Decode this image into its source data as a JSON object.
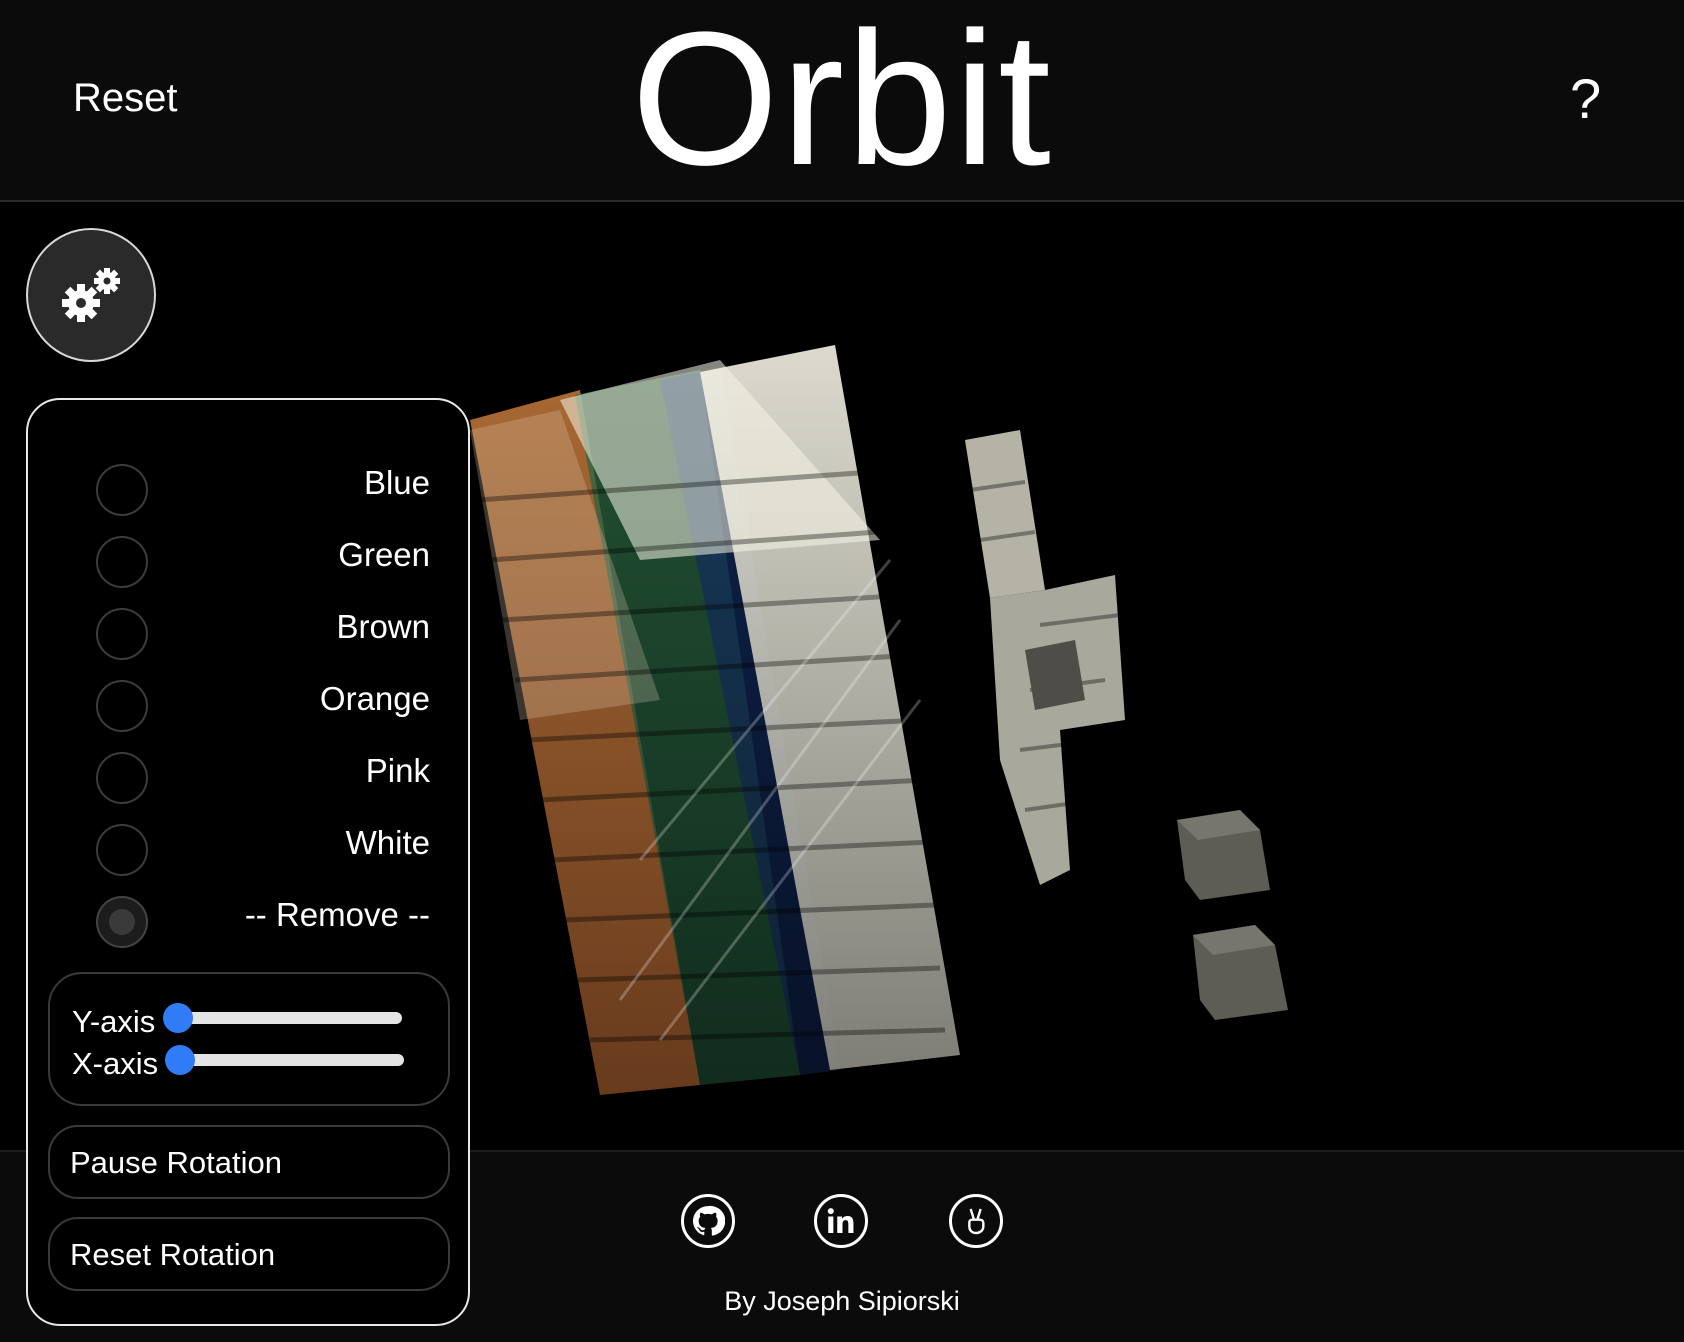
{
  "header": {
    "reset_label": "Reset",
    "title": "Orbit",
    "help_label": "?"
  },
  "settings": {
    "icon": "gears-icon"
  },
  "panel": {
    "colors": [
      {
        "label": "Blue",
        "checked": false
      },
      {
        "label": "Green",
        "checked": false
      },
      {
        "label": "Brown",
        "checked": false
      },
      {
        "label": "Orange",
        "checked": false
      },
      {
        "label": "Pink",
        "checked": false
      },
      {
        "label": "White",
        "checked": false
      },
      {
        "label": "-- Remove --",
        "checked": true
      }
    ],
    "y_axis_label": "Y-axis",
    "x_axis_label": "X-axis",
    "y_axis_value": 0,
    "x_axis_value": 0,
    "pause_label": "Pause Rotation",
    "reset_rotation_label": "Reset Rotation",
    "slider_color": "#2f7cf6"
  },
  "footer": {
    "links": [
      {
        "icon": "github-icon"
      },
      {
        "icon": "linkedin-icon"
      },
      {
        "icon": "peace-hand-icon"
      }
    ],
    "credit": "By Joseph Sipiorski"
  }
}
